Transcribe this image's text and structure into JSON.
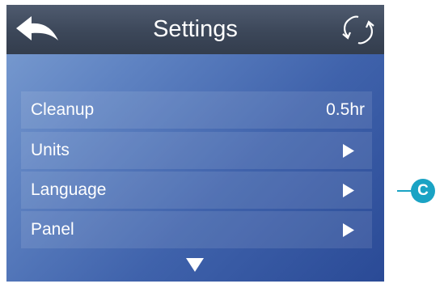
{
  "header": {
    "title": "Settings",
    "back_icon": "back-arrow-icon",
    "refresh_icon": "refresh-icon"
  },
  "settings": {
    "items": [
      {
        "label": "Cleanup",
        "value": "0.5hr"
      },
      {
        "label": "Units",
        "icon": "play-arrow-icon"
      },
      {
        "label": "Language",
        "icon": "play-arrow-icon"
      },
      {
        "label": "Panel",
        "icon": "play-arrow-icon"
      }
    ],
    "scroll_icon": "down-triangle-icon"
  },
  "callout": {
    "letter": "C",
    "color": "#1aa3c4"
  },
  "colors": {
    "topbar": "#3c4759",
    "background_light": "#7d9fd2",
    "background_dark": "#2a4a96",
    "text": "#ffffff"
  }
}
